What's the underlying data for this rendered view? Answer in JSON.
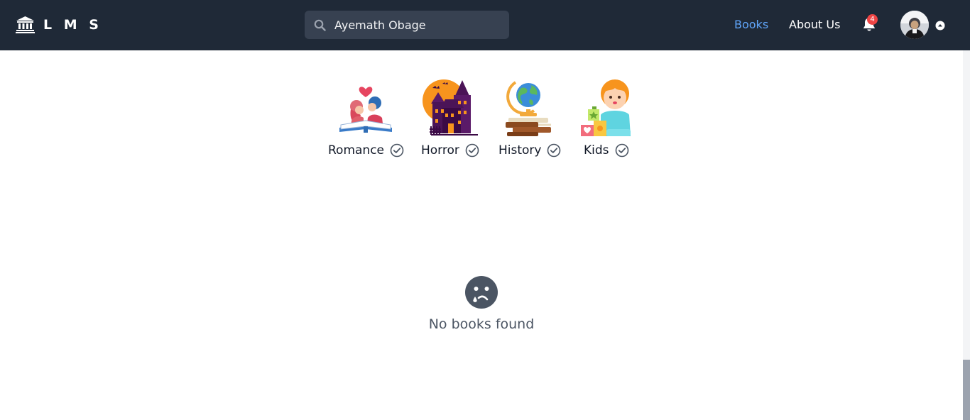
{
  "brand": {
    "text": "L M S",
    "icon": "bank-icon"
  },
  "search": {
    "value": "Ayemath Obage",
    "placeholder": "Search"
  },
  "nav": {
    "books": "Books",
    "about": "About Us"
  },
  "notifications": {
    "count": "4"
  },
  "categories": [
    {
      "label": "Romance",
      "icon": "romance-illustration"
    },
    {
      "label": "Horror",
      "icon": "horror-illustration"
    },
    {
      "label": "History",
      "icon": "history-illustration"
    },
    {
      "label": "Kids",
      "icon": "kids-illustration"
    }
  ],
  "empty_state": {
    "text": "No books found",
    "icon": "sad-face-icon"
  },
  "colors": {
    "navbar": "#1f2937",
    "active_link": "#60a5fa",
    "badge": "#ef4444"
  }
}
